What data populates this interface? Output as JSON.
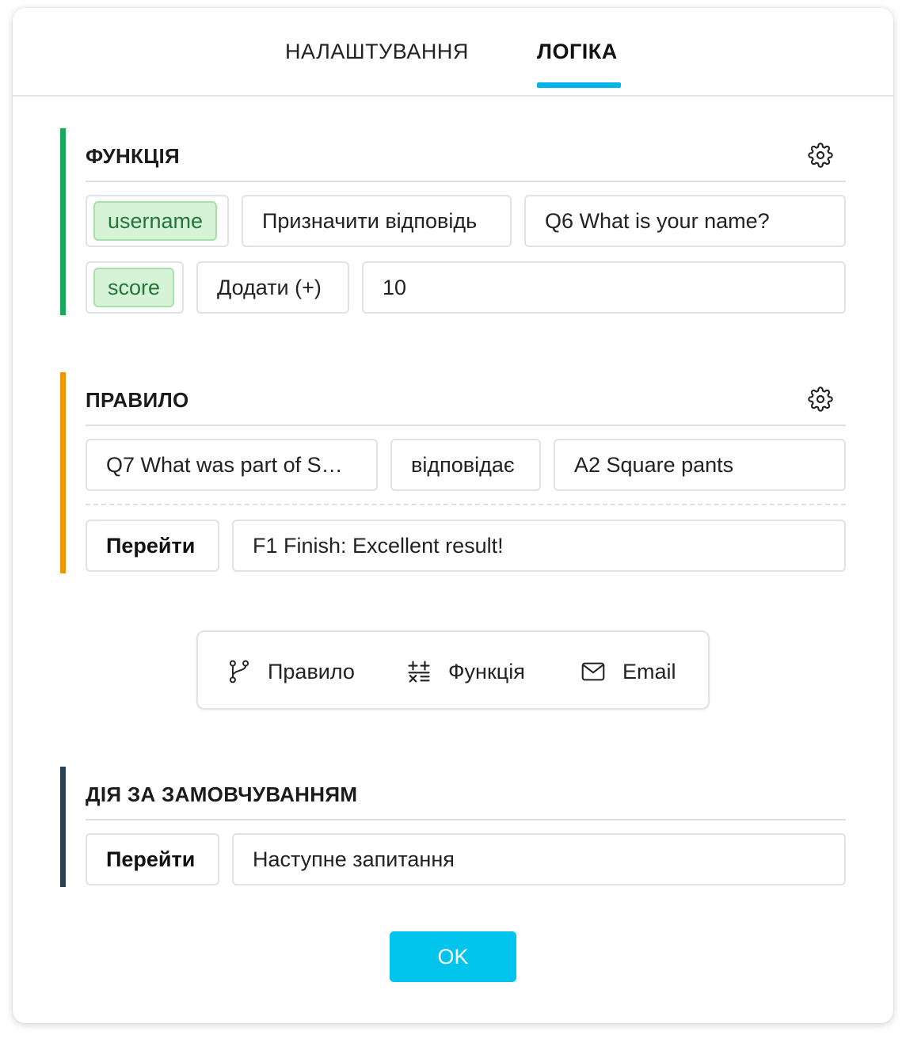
{
  "tabs": [
    {
      "label": "НАЛАШТУВАННЯ",
      "active": false
    },
    {
      "label": "ЛОГІКА",
      "active": true
    }
  ],
  "colors": {
    "accent": "#00b6e6",
    "function_bar": "#1aa85a",
    "rule_bar": "#f59300",
    "default_bar": "#2c4052",
    "tag_bg": "#d6f2d7"
  },
  "function_section": {
    "title": "ФУНКЦІЯ",
    "rows": [
      {
        "variable": "username",
        "operation": "Призначити відповідь",
        "value": "Q6 What is your name?"
      },
      {
        "variable": "score",
        "operation": "Додати (+)",
        "value": "10"
      }
    ]
  },
  "rule_section": {
    "title": "ПРАВИЛО",
    "condition": {
      "question": "Q7 What was part of S…",
      "operator": "відповідає",
      "answer": "A2 Square pants"
    },
    "action": {
      "label": "Перейти",
      "target": "F1 Finish: Excellent result!"
    }
  },
  "add_bar": {
    "rule": "Правило",
    "function": "Функція",
    "email": "Email"
  },
  "default_section": {
    "title": "ДІЯ ЗА ЗАМОВЧУВАННЯМ",
    "action": {
      "label": "Перейти",
      "target": "Наступне запитання"
    }
  },
  "ok_label": "OK",
  "icons": {
    "gear": "gear-icon",
    "branch": "branch-icon",
    "calculator": "calculator-icon",
    "email": "envelope-icon"
  }
}
